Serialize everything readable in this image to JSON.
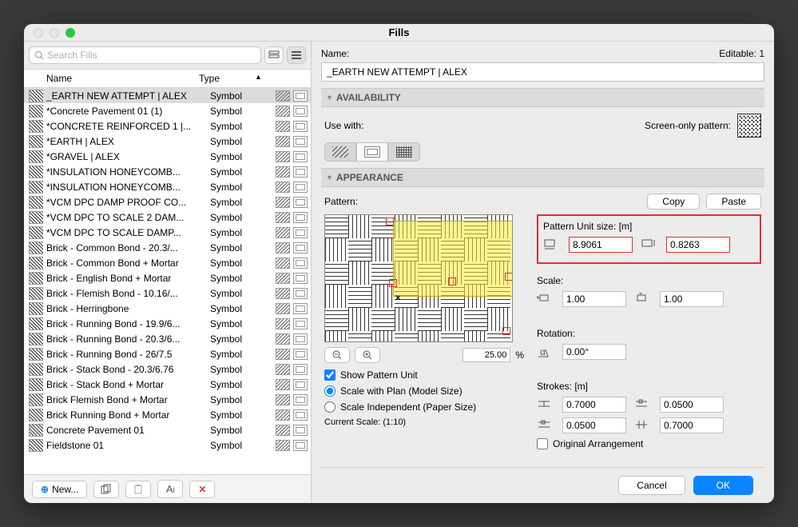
{
  "window": {
    "title": "Fills"
  },
  "search": {
    "placeholder": "Search Fills"
  },
  "list": {
    "headers": {
      "name": "Name",
      "type": "Type"
    },
    "selected": 0,
    "items": [
      {
        "name": "_EARTH NEW ATTEMPT | ALEX",
        "type": "Symbol"
      },
      {
        "name": "*Concrete Pavement 01 (1)",
        "type": "Symbol"
      },
      {
        "name": "*CONCRETE REINFORCED 1 |...",
        "type": "Symbol"
      },
      {
        "name": "*EARTH | ALEX",
        "type": "Symbol"
      },
      {
        "name": "*GRAVEL | ALEX",
        "type": "Symbol"
      },
      {
        "name": "*INSULATION HONEYCOMB...",
        "type": "Symbol"
      },
      {
        "name": "*INSULATION HONEYCOMB...",
        "type": "Symbol"
      },
      {
        "name": "*VCM DPC DAMP PROOF CO...",
        "type": "Symbol"
      },
      {
        "name": "*VCM DPC TO SCALE 2 DAM...",
        "type": "Symbol"
      },
      {
        "name": "*VCM DPC TO SCALE DAMP...",
        "type": "Symbol"
      },
      {
        "name": "Brick - Common Bond - 20.3/...",
        "type": "Symbol"
      },
      {
        "name": "Brick - Common Bond + Mortar",
        "type": "Symbol"
      },
      {
        "name": "Brick - English Bond + Mortar",
        "type": "Symbol"
      },
      {
        "name": "Brick - Flemish Bond - 10.16/...",
        "type": "Symbol"
      },
      {
        "name": "Brick - Herringbone",
        "type": "Symbol"
      },
      {
        "name": "Brick - Running Bond - 19.9/6...",
        "type": "Symbol"
      },
      {
        "name": "Brick - Running Bond - 20.3/6...",
        "type": "Symbol"
      },
      {
        "name": "Brick - Running Bond - 26/7.5",
        "type": "Symbol"
      },
      {
        "name": "Brick - Stack Bond - 20.3/6.76",
        "type": "Symbol"
      },
      {
        "name": "Brick - Stack Bond + Mortar",
        "type": "Symbol"
      },
      {
        "name": "Brick Flemish Bond + Mortar",
        "type": "Symbol"
      },
      {
        "name": "Brick Running Bond + Mortar",
        "type": "Symbol"
      },
      {
        "name": "Concrete Pavement 01",
        "type": "Symbol"
      },
      {
        "name": "Fieldstone 01",
        "type": "Symbol"
      }
    ]
  },
  "bottom": {
    "new": "New...",
    "delete": "✕"
  },
  "right": {
    "name_label": "Name:",
    "editable_label": "Editable: 1",
    "name_value": "_EARTH NEW ATTEMPT | ALEX",
    "availability": "AVAILABILITY",
    "use_with": "Use with:",
    "screen_only": "Screen-only pattern:",
    "appearance": "APPEARANCE",
    "pattern": "Pattern:",
    "copy": "Copy",
    "paste": "Paste",
    "zoom_pct": "25.00",
    "pct": "%",
    "show_pattern_unit": "Show Pattern Unit",
    "scale_plan": "Scale with Plan (Model Size)",
    "scale_indep": "Scale Independent (Paper Size)",
    "current_scale": "Current Scale: (1:10)",
    "pattern_unit_size": "Pattern Unit size: [m]",
    "pu_w": "8.9061",
    "pu_h": "0.8263",
    "scale_label": "Scale:",
    "scale_x": "1.00",
    "scale_y": "1.00",
    "rotation_label": "Rotation:",
    "rotation": "0.00°",
    "strokes_label": "Strokes: [m]",
    "st1": "0.7000",
    "st2": "0.0500",
    "st3": "0.0500",
    "st4": "0.7000",
    "orig_arr": "Original Arrangement"
  },
  "footer": {
    "cancel": "Cancel",
    "ok": "OK"
  }
}
